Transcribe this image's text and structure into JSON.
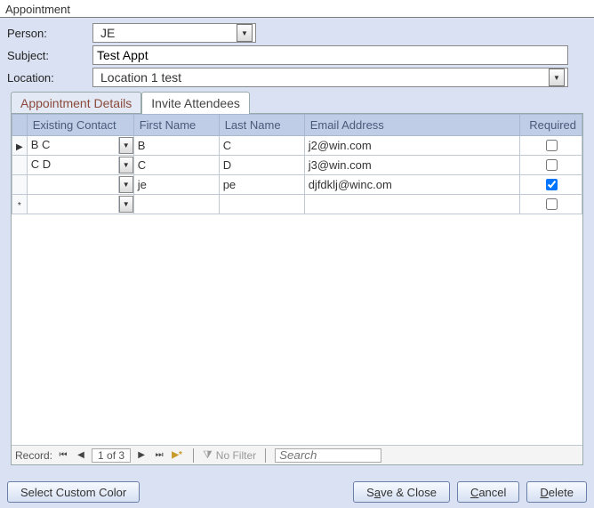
{
  "window": {
    "title": "Appointment"
  },
  "form": {
    "person_label": "Person:",
    "person_value": "JE",
    "subject_label": "Subject:",
    "subject_value": "Test Appt",
    "location_label": "Location:",
    "location_value": "Location 1 test"
  },
  "tabs": {
    "details": "Appointment Details",
    "invite": "Invite Attendees"
  },
  "grid": {
    "headers": {
      "existing": "Existing Contact",
      "first": "First Name",
      "last": "Last Name",
      "email": "Email Address",
      "required": "Required"
    },
    "rows": [
      {
        "marker": "▶",
        "existing": "B C",
        "first": "B",
        "last": "C",
        "email": "j2@win.com",
        "required": false
      },
      {
        "marker": "",
        "existing": "C D",
        "first": "C",
        "last": "D",
        "email": "j3@win.com",
        "required": false
      },
      {
        "marker": "",
        "existing": "",
        "first": "je",
        "last": "pe",
        "email": "djfdklj@winc.om",
        "required": true
      },
      {
        "marker": "*",
        "existing": "",
        "first": "",
        "last": "",
        "email": "",
        "required": false
      }
    ]
  },
  "nav": {
    "record_label": "Record:",
    "position": "1 of 3",
    "nofilter": "No Filter",
    "search_placeholder": "Search"
  },
  "buttons": {
    "color": "Select Custom Color",
    "save_pre": "S",
    "save_u": "a",
    "save_post": "ve & Close",
    "cancel_u": "C",
    "cancel_post": "ancel",
    "delete_u": "D",
    "delete_post": "elete"
  }
}
